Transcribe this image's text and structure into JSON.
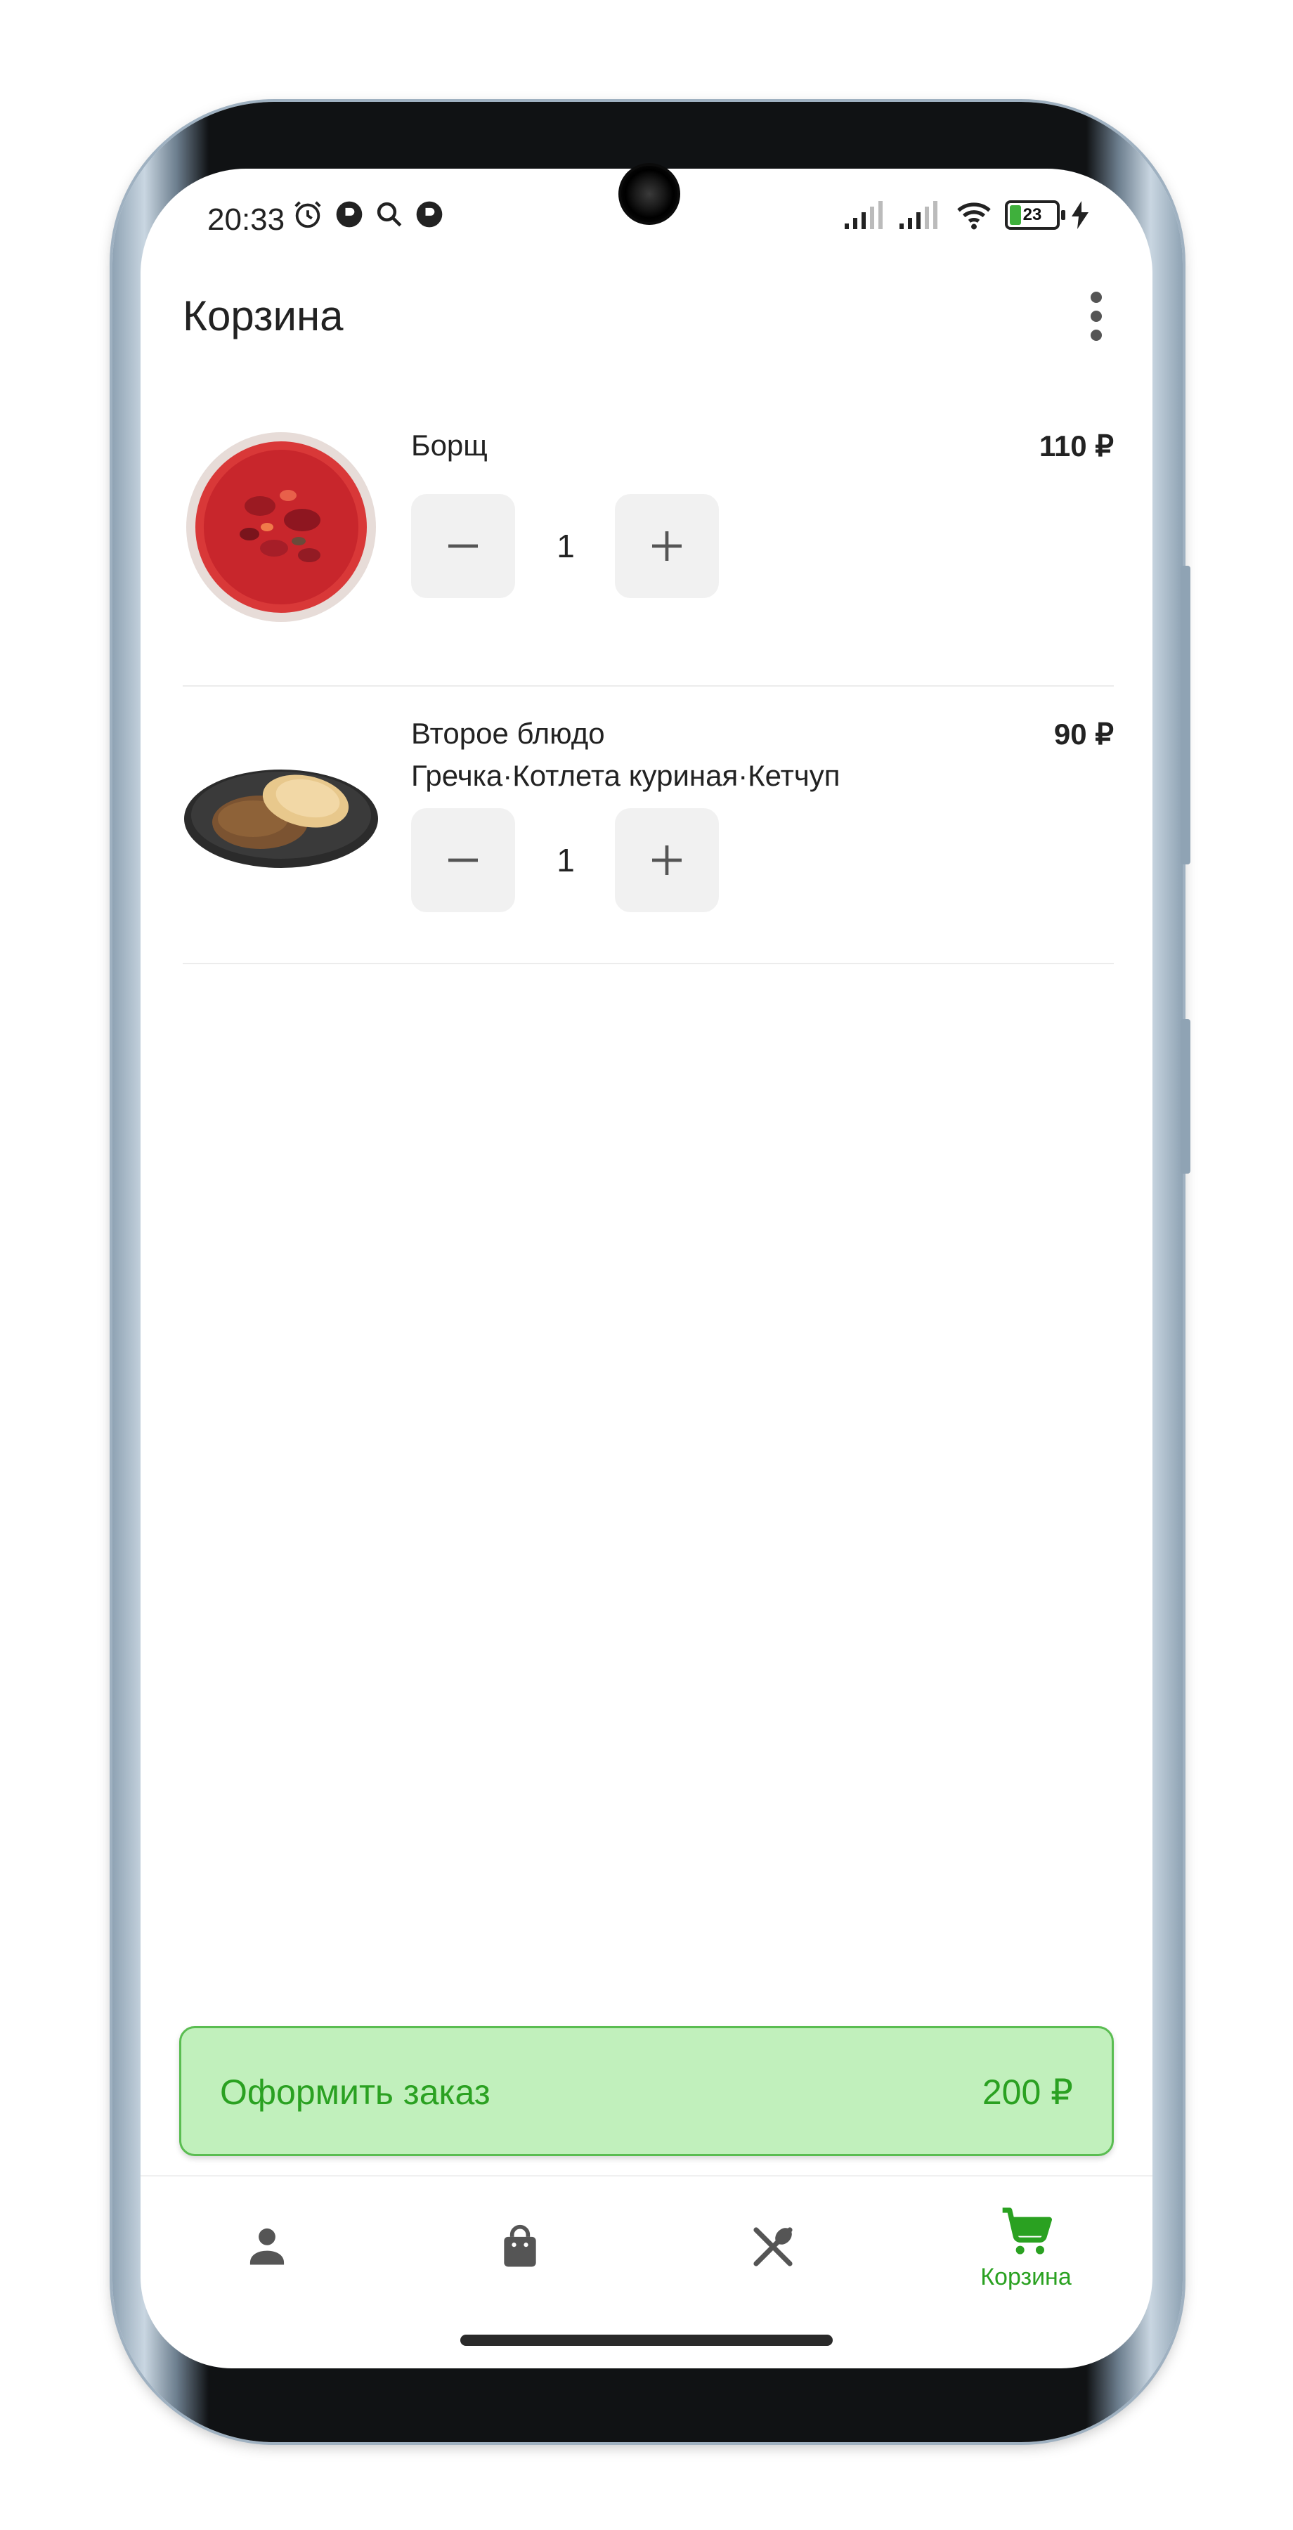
{
  "status_bar": {
    "time": "20:33",
    "battery_level": "23",
    "battery_fraction": 0.23
  },
  "header": {
    "title": "Корзина",
    "menu_icon": "more-vert-icon"
  },
  "cart": {
    "items": [
      {
        "name": "Борщ",
        "options": "",
        "price": "110 ₽",
        "quantity": "1",
        "image": "borscht-bowl-image"
      },
      {
        "name": "Второе блюдо",
        "options": "Гречка·Котлета куриная·Кетчуп",
        "price": "90 ₽",
        "quantity": "1",
        "image": "buckwheat-cutlet-plate-image"
      }
    ],
    "decrease_icon": "minus-icon",
    "increase_icon": "plus-icon"
  },
  "checkout": {
    "label": "Оформить заказ",
    "total": "200 ₽"
  },
  "bottom_nav": {
    "items": [
      {
        "icon": "person-icon",
        "label": "",
        "active": false
      },
      {
        "icon": "shopping-bag-icon",
        "label": "",
        "active": false
      },
      {
        "icon": "fork-spoon-icon",
        "label": "",
        "active": false
      },
      {
        "icon": "cart-icon",
        "label": "Корзина",
        "active": true
      }
    ]
  },
  "colors": {
    "accent": "#2aa121",
    "checkout_bg": "#c1f0bc",
    "inactive_icon": "#555555"
  }
}
